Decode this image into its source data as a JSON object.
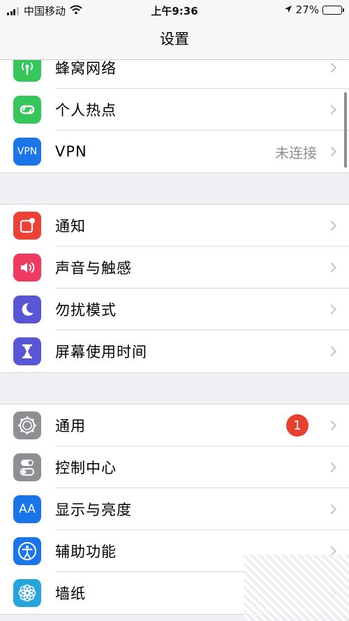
{
  "status_bar": {
    "carrier": "中国移动",
    "time": "上午9:36",
    "battery": "27%",
    "battery_level": 0.27
  },
  "nav": {
    "title": "设置"
  },
  "groups": [
    {
      "rows": [
        {
          "label": "蜂窝网络",
          "icon": "cellular-antenna-icon",
          "color": "#35c759"
        },
        {
          "label": "个人热点",
          "icon": "hotspot-link-icon",
          "color": "#35c759"
        },
        {
          "label": "VPN",
          "icon": "vpn-icon",
          "icon_text": "VPN",
          "color": "#1b75ea",
          "detail": "未连接"
        }
      ]
    },
    {
      "rows": [
        {
          "label": "通知",
          "icon": "notifications-icon",
          "color": "#ee4036"
        },
        {
          "label": "声音与触感",
          "icon": "speaker-icon",
          "color": "#ee3b5f"
        },
        {
          "label": "勿扰模式",
          "icon": "moon-icon",
          "color": "#5856d6"
        },
        {
          "label": "屏幕使用时间",
          "icon": "hourglass-icon",
          "color": "#5856d6"
        }
      ]
    },
    {
      "rows": [
        {
          "label": "通用",
          "icon": "gear-icon",
          "color": "#8e8e93",
          "badge": "1"
        },
        {
          "label": "控制中心",
          "icon": "toggles-icon",
          "color": "#8e8e93"
        },
        {
          "label": "显示与亮度",
          "icon": "text-size-icon",
          "icon_text": "AA",
          "color": "#1b75ea"
        },
        {
          "label": "辅助功能",
          "icon": "accessibility-icon",
          "color": "#1b75ea"
        },
        {
          "label": "墙纸",
          "icon": "wallpaper-flower-icon",
          "color": "#26a4de"
        }
      ]
    }
  ]
}
